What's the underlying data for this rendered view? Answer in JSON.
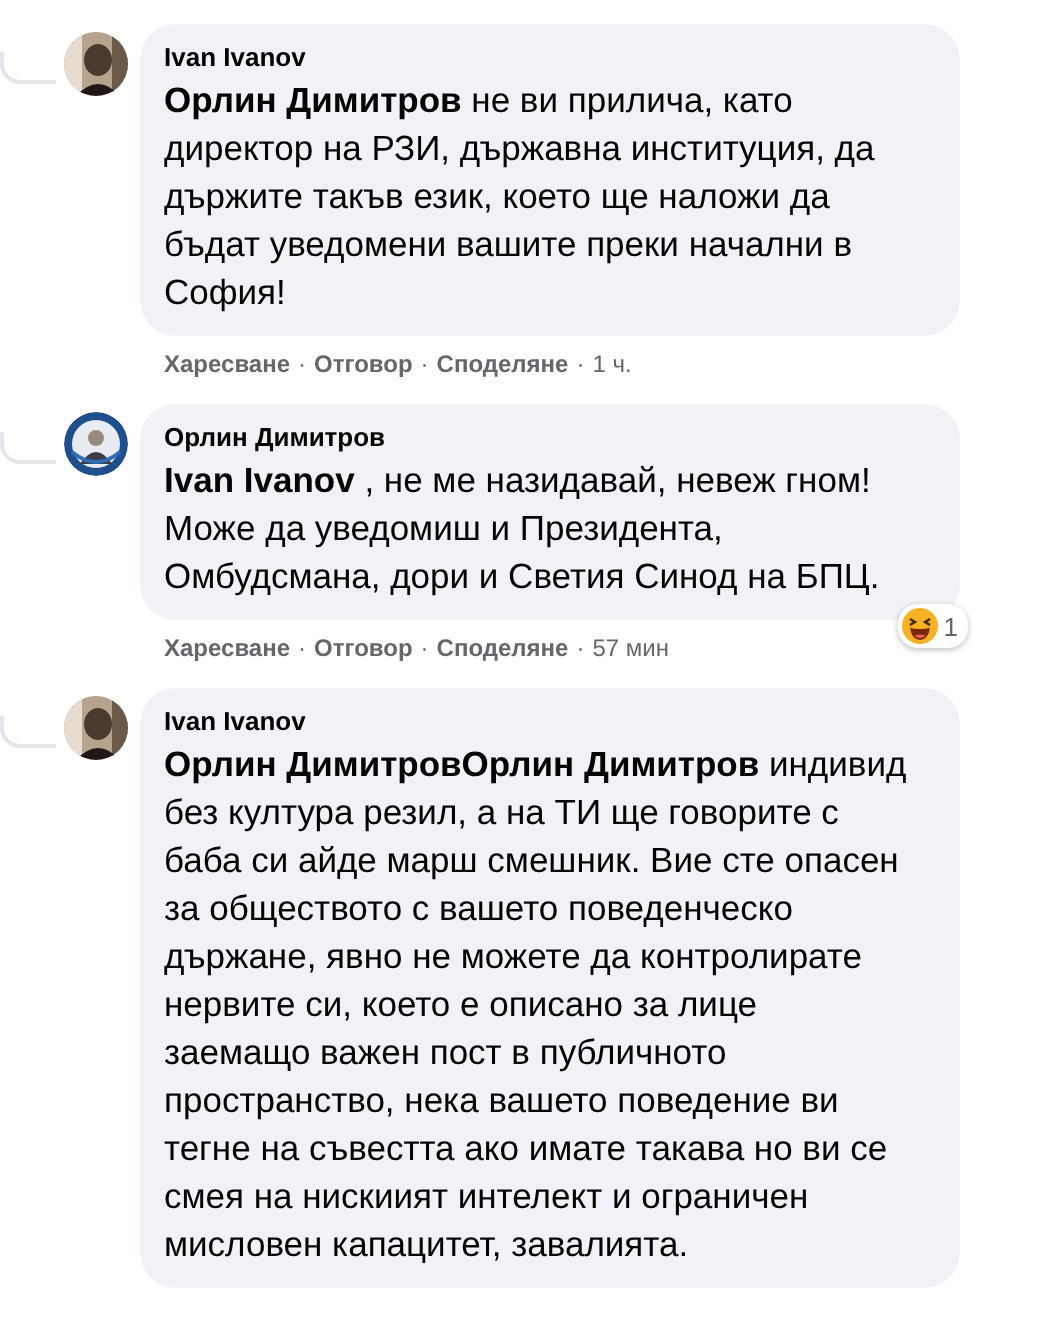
{
  "separator": "·",
  "comments": [
    {
      "author": "Ivan Ivanov",
      "text": "**Орлин Димитров** не ви прилича, като директор на РЗИ, държавна институция, да държите такъв език, което ще наложи да бъдат уведомени вашите преки начални в София!",
      "actions": [
        "Харесване",
        "Отговор",
        "Споделяне"
      ],
      "time": "1 ч."
    },
    {
      "author": "Орлин Димитров",
      "text": "**Ivan Ivanov** , не ме назидавай, невеж гном! Може да уведомиш и Президента, Омбудсмана, дори и Светия Синод на БПЦ.",
      "actions": [
        "Харесване",
        "Отговор",
        "Споделяне"
      ],
      "time": "57 мин",
      "reaction": {
        "count": "1"
      }
    },
    {
      "author": "Ivan Ivanov",
      "text": "**Орлин ДимитровОрлин Димитров** индивид без култура резил, а на ТИ ще говорите с баба си айде марш смешник. Вие сте опасен за обществото с вашето поведенческо държане, явно не можете да контролирате нервите си, което е описано за лице заемащо важен пост в публичното пространство, нека вашето поведение ви тегне на съвестта ако имате такава но ви се смея на нискиият интелект и ограничен мисловен капацитет, завалията."
    }
  ]
}
